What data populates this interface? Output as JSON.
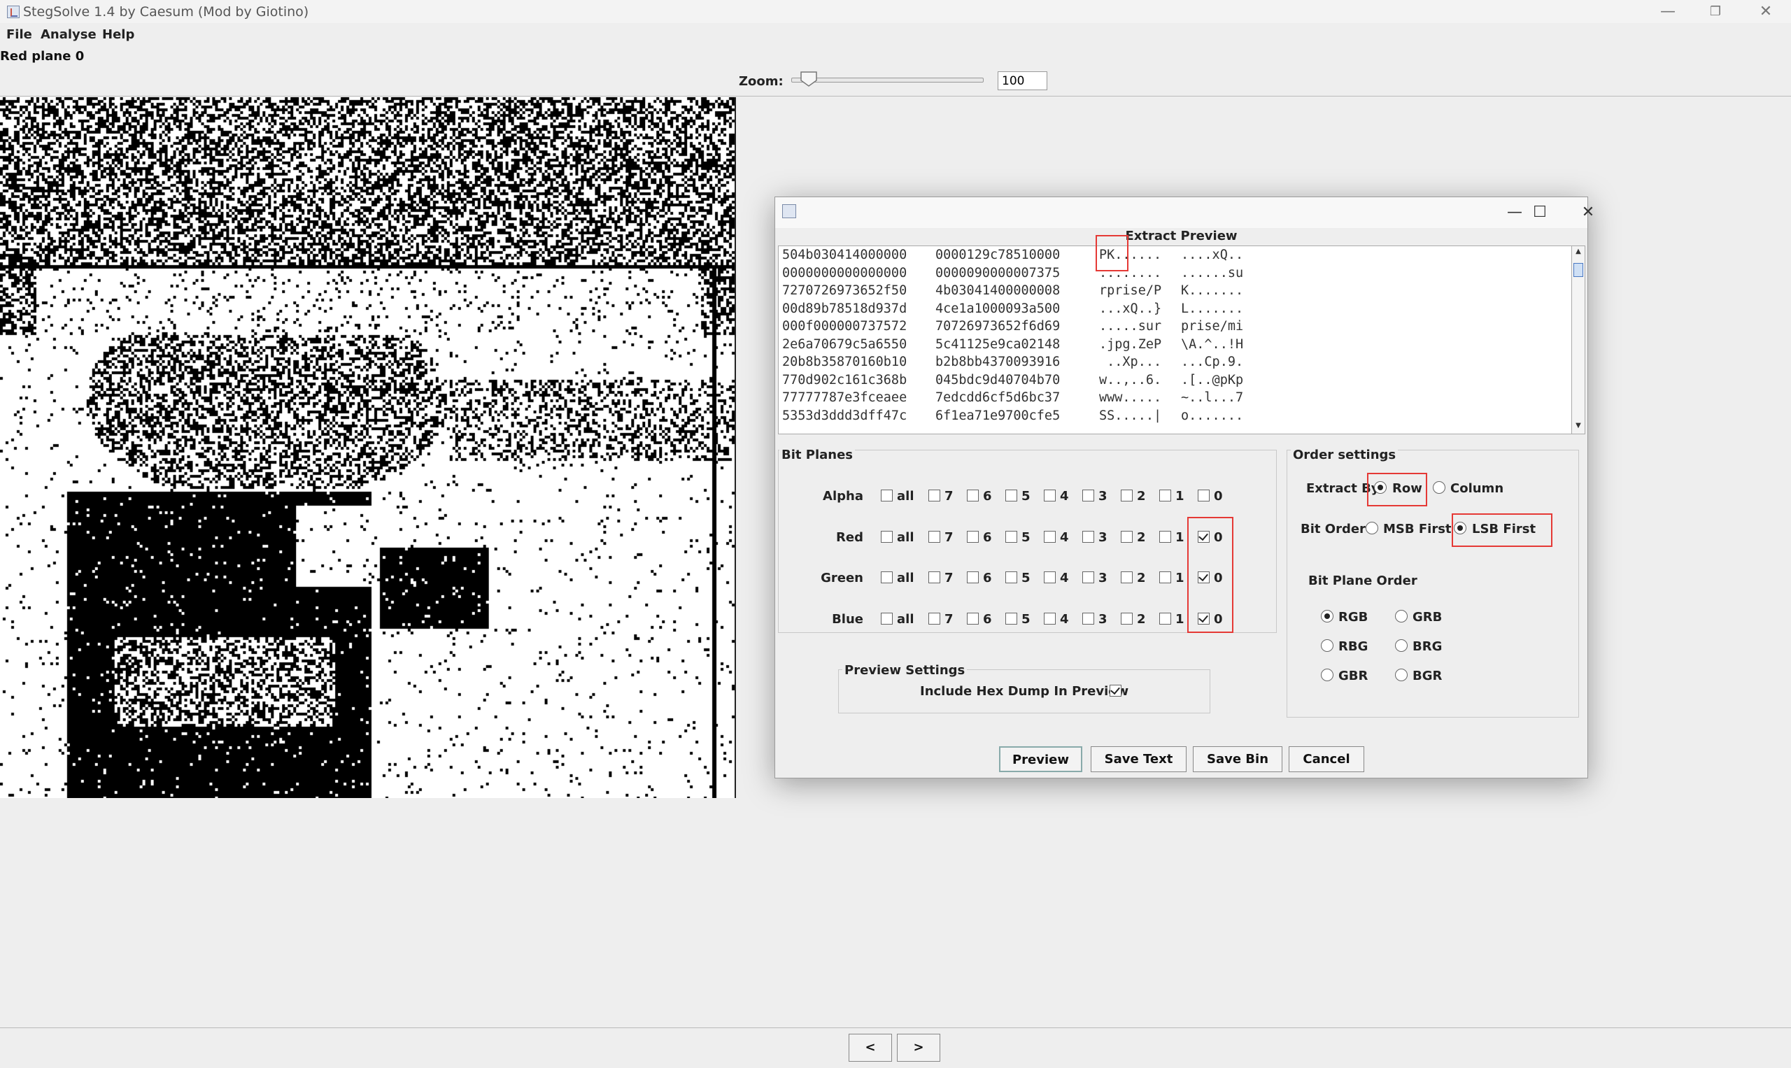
{
  "window": {
    "title": "StegSolve 1.4 by Caesum (Mod by Giotino)",
    "min": "—",
    "restore": "❐",
    "close": "✕"
  },
  "menu": [
    "File",
    "Analyse",
    "Help"
  ],
  "status": "Red plane 0",
  "zoom": {
    "label": "Zoom:",
    "value": "100",
    "slider_fraction": 0.08
  },
  "nav": {
    "prev": "<",
    "next": ">"
  },
  "dialog": {
    "title_buttons": {
      "min": "—",
      "max": "☐",
      "close": "✕"
    },
    "heading": "Extract Preview",
    "hex_rows": [
      [
        "504b030414000000",
        "0000129c78510000",
        "PK......",
        "....xQ.."
      ],
      [
        "0000000000000000",
        "0000090000007375",
        "........",
        "......su"
      ],
      [
        "7270726973652f50",
        "4b03041400000008",
        "rprise/P",
        "K......."
      ],
      [
        "00d89b78518d937d",
        "4ce1a1000093a500",
        "...xQ..}",
        "L......."
      ],
      [
        "000f000000737572",
        "70726973652f6d69",
        ".....sur",
        "prise/mi"
      ],
      [
        "2e6a70679c5a6550",
        "5c41125e9ca02148",
        ".jpg.ZeP",
        "\\A.^..!H"
      ],
      [
        "20b8b35870160b10",
        "b2b8bb4370093916",
        " ..Xp...",
        "...Cp.9."
      ],
      [
        "770d902c161c368b",
        "045bdc9d40704b70",
        "w..,..6.",
        ".[..@pKp"
      ],
      [
        "77777787e3fceaee",
        "7edcdd6cf5d6bc37",
        "www.....",
        "~..l...7"
      ],
      [
        "5353d3ddd3dff47c",
        "6f1ea71e9700cfe5",
        "SS.....|",
        "o......."
      ]
    ],
    "bit_planes": {
      "title": "Bit Planes",
      "rows": [
        {
          "label": "Alpha",
          "checked": []
        },
        {
          "label": "Red",
          "checked": [
            "0"
          ]
        },
        {
          "label": "Green",
          "checked": [
            "0"
          ]
        },
        {
          "label": "Blue",
          "checked": [
            "0"
          ]
        }
      ],
      "options": [
        "all",
        "7",
        "6",
        "5",
        "4",
        "3",
        "2",
        "1",
        "0"
      ]
    },
    "order": {
      "title": "Order settings",
      "extract_by_label": "Extract By",
      "extract_by": [
        "Row",
        "Column"
      ],
      "extract_by_selected": "Row",
      "bit_order_label": "Bit Order",
      "bit_order": [
        "MSB First",
        "LSB First"
      ],
      "bit_order_selected": "LSB First",
      "plane_order_title": "Bit Plane Order",
      "plane_orders": [
        "RGB",
        "GRB",
        "RBG",
        "BRG",
        "GBR",
        "BGR"
      ],
      "plane_order_selected": "RGB"
    },
    "preview_settings": {
      "title": "Preview Settings",
      "hexdump_label": "Include Hex Dump In Preview",
      "hexdump_checked": true
    },
    "buttons": {
      "preview": "Preview",
      "save_text": "Save Text",
      "save_bin": "Save Bin",
      "cancel": "Cancel"
    }
  }
}
